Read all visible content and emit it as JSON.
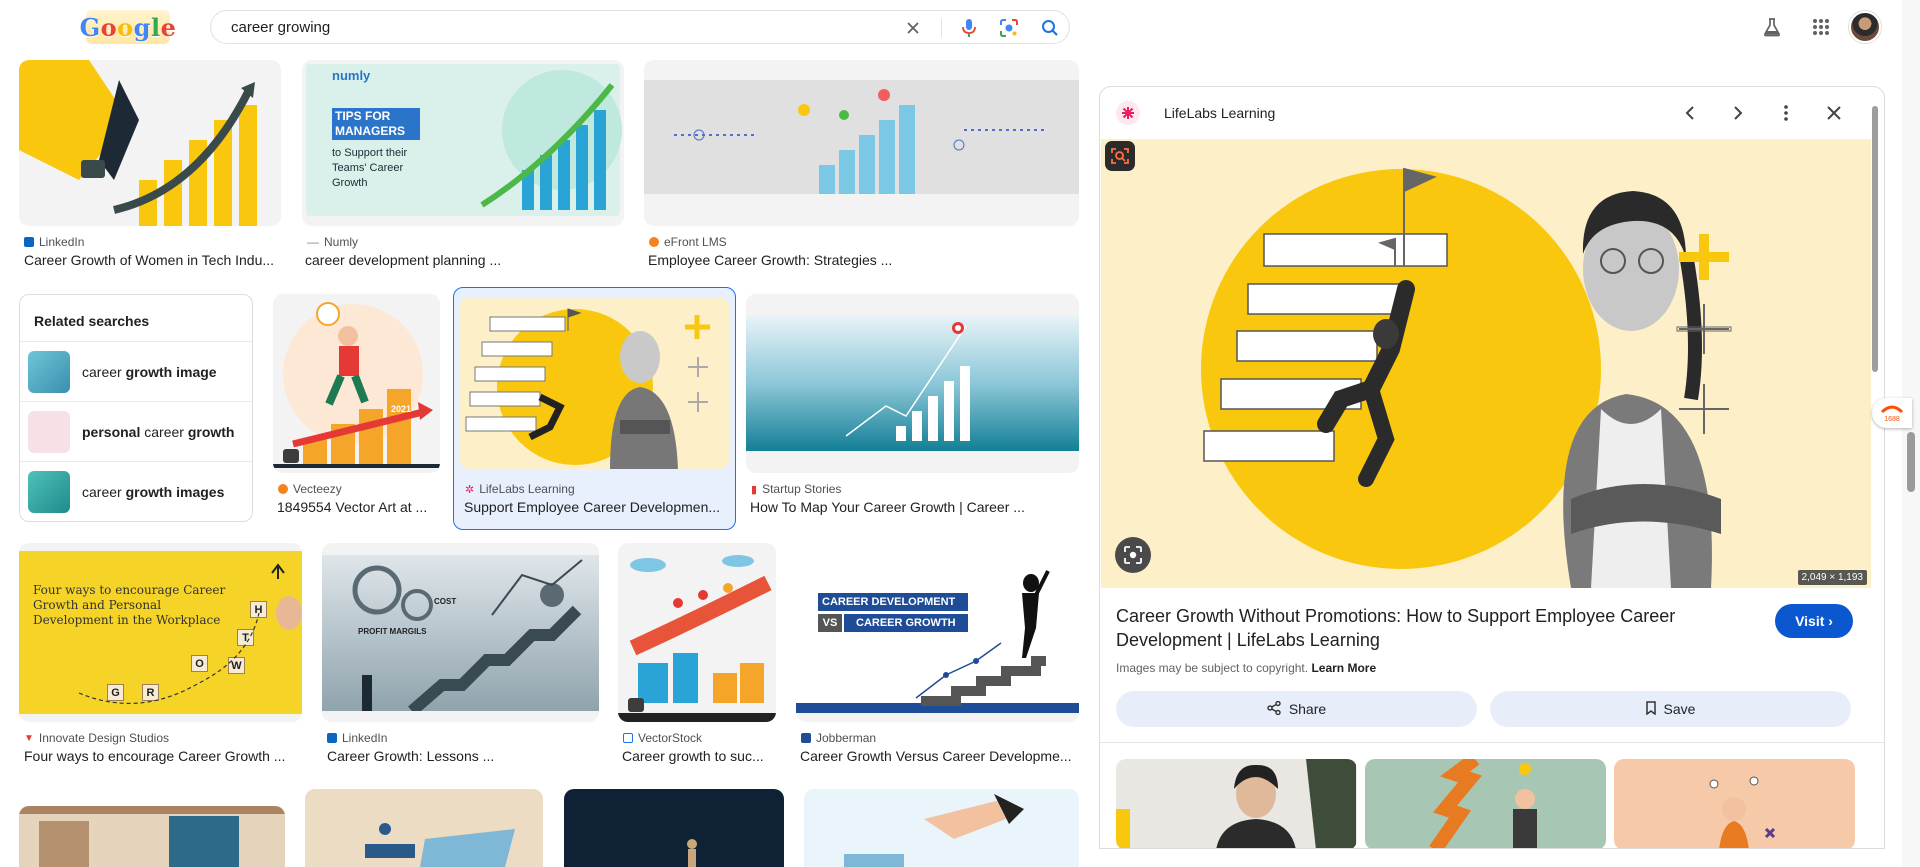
{
  "logo": {
    "letters": [
      "G",
      "o",
      "o",
      "g",
      "l",
      "e"
    ]
  },
  "search": {
    "query": "career growing"
  },
  "icons": {
    "clear": "close-icon",
    "voice": "mic-icon",
    "lens": "lens-icon",
    "search": "search-icon",
    "labs": "flask-icon",
    "apps": "apps-grid-icon",
    "account": "avatar"
  },
  "results": [
    {
      "source": "LinkedIn",
      "title": "Career Growth of Women in Tech Indu..."
    },
    {
      "source": "Numly",
      "title": "career development planning ...",
      "thumb_text": {
        "brand": "numly",
        "headline": "TIPS FOR MANAGERS",
        "sub": "to Support their Teams' Career Growth"
      }
    },
    {
      "source": "eFront LMS",
      "title": "Employee Career Growth: Strategies ..."
    },
    {
      "source": "Vecteezy",
      "title": "1849554 Vector Art at ...",
      "thumb_text": {
        "year": "2021"
      }
    },
    {
      "source": "LifeLabs Learning",
      "title": "Support Employee Career Developmen..."
    },
    {
      "source": "Startup Stories",
      "title": "How To Map Your Career Growth | Career ..."
    },
    {
      "source": "Innovate Design Studios",
      "title": "Four ways to encourage Career Growth ...",
      "thumb_text": {
        "headline": "Four ways to encourage Career Growth and Personal Development in the Workplace",
        "tiles": [
          "G",
          "R",
          "O",
          "W",
          "T",
          "H"
        ]
      }
    },
    {
      "source": "LinkedIn",
      "title": "Career Growth: Lessons ...",
      "thumb_text": {
        "l1": "COST",
        "l2": "PROFIT MARGILS"
      }
    },
    {
      "source": "VectorStock",
      "title": "Career growth to suc..."
    },
    {
      "source": "Jobberman",
      "title": "Career Growth Versus Career Developme...",
      "thumb_text": {
        "l1": "CAREER DEVELOPMENT",
        "vs": "VS",
        "l2": "CAREER GROWTH"
      }
    }
  ],
  "related": {
    "title": "Related searches",
    "items": [
      {
        "plain": "career ",
        "bold": "growth image"
      },
      {
        "plain": "",
        "bold": "personal",
        "rest": " career ",
        "bold2": "growth"
      },
      {
        "plain": "career ",
        "bold": "growth images"
      }
    ]
  },
  "panel": {
    "source": "LifeLabs Learning",
    "dimensions": "2,049 × 1,193",
    "title": "Career Growth Without Promotions: How to Support Employee Career Development | LifeLabs Learning",
    "visit_label": "Visit",
    "copyright": "Images may be subject to copyright.",
    "learn_more": "Learn More",
    "share_label": "Share",
    "save_label": "Save"
  },
  "colors": {
    "accent": "#0b57d0",
    "yellow": "#f9c80e",
    "selected_bg": "#e8f0fe",
    "selected_border": "#1a73e8"
  }
}
